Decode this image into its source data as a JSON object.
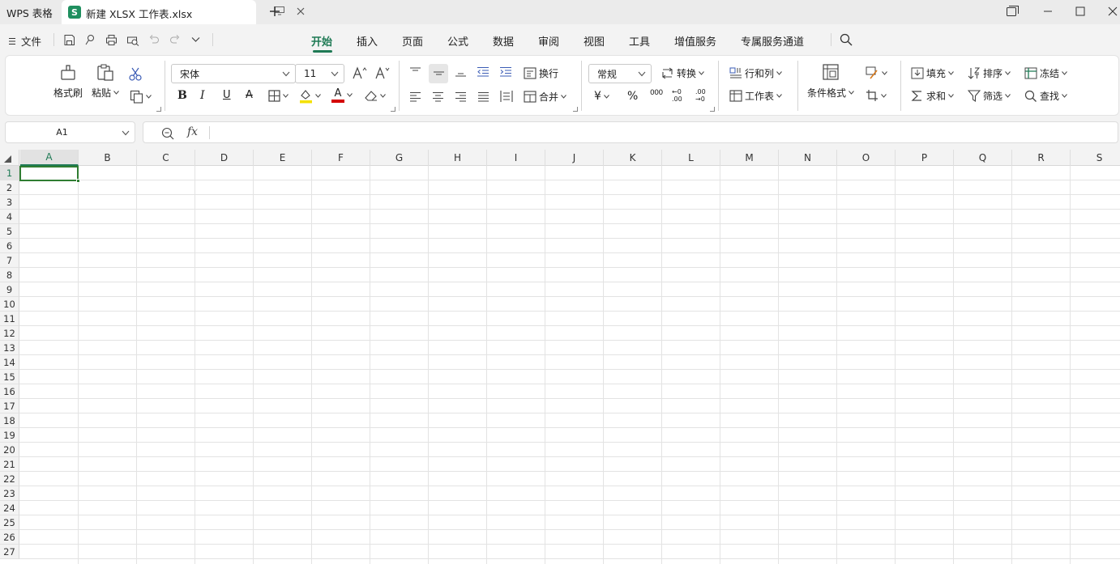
{
  "app": {
    "name": "WPS 表格"
  },
  "doc_tab": {
    "badge": "S",
    "title": "新建 XLSX 工作表.xlsx"
  },
  "menu": {
    "file": "文件",
    "tabs": [
      "开始",
      "插入",
      "页面",
      "公式",
      "数据",
      "审阅",
      "视图",
      "工具",
      "增值服务",
      "专属服务通道"
    ],
    "active_tab": "开始"
  },
  "ribbon": {
    "format_painter": "格式刷",
    "paste": "粘贴",
    "font_name": "宋体",
    "font_size": "11",
    "wrap": "换行",
    "merge": "合并",
    "number_format": "常规",
    "convert": "转换",
    "rows_cols": "行和列",
    "worksheet": "工作表",
    "cond_format": "条件格式",
    "fill": "填充",
    "sort": "排序",
    "freeze": "冻结",
    "sum": "求和",
    "filter": "筛选",
    "find": "查找",
    "bold": "B",
    "italic": "I",
    "underline": "U",
    "strike": "A",
    "font_color_glyph": "A",
    "currency": "¥",
    "percent": "%",
    "thousands": "000",
    "inc_decimal": "←0 .00",
    "dec_decimal": ".00 →0",
    "colors": {
      "highlight": "#f4e100",
      "font_color": "#d40000",
      "accent": "#1f7a55"
    }
  },
  "formula_bar": {
    "name_box": "A1",
    "fx": "fx",
    "value": ""
  },
  "grid": {
    "columns": [
      "A",
      "B",
      "C",
      "D",
      "E",
      "F",
      "G",
      "H",
      "I",
      "J",
      "K",
      "L",
      "M",
      "N",
      "O",
      "P",
      "Q",
      "R",
      "S"
    ],
    "rows": [
      "1",
      "2",
      "3",
      "4",
      "5",
      "6",
      "7",
      "8",
      "9",
      "10",
      "11",
      "12",
      "13",
      "14",
      "15",
      "16",
      "17",
      "18",
      "19",
      "20",
      "21",
      "22",
      "23",
      "24",
      "25",
      "26",
      "27"
    ],
    "selected": "A1"
  }
}
